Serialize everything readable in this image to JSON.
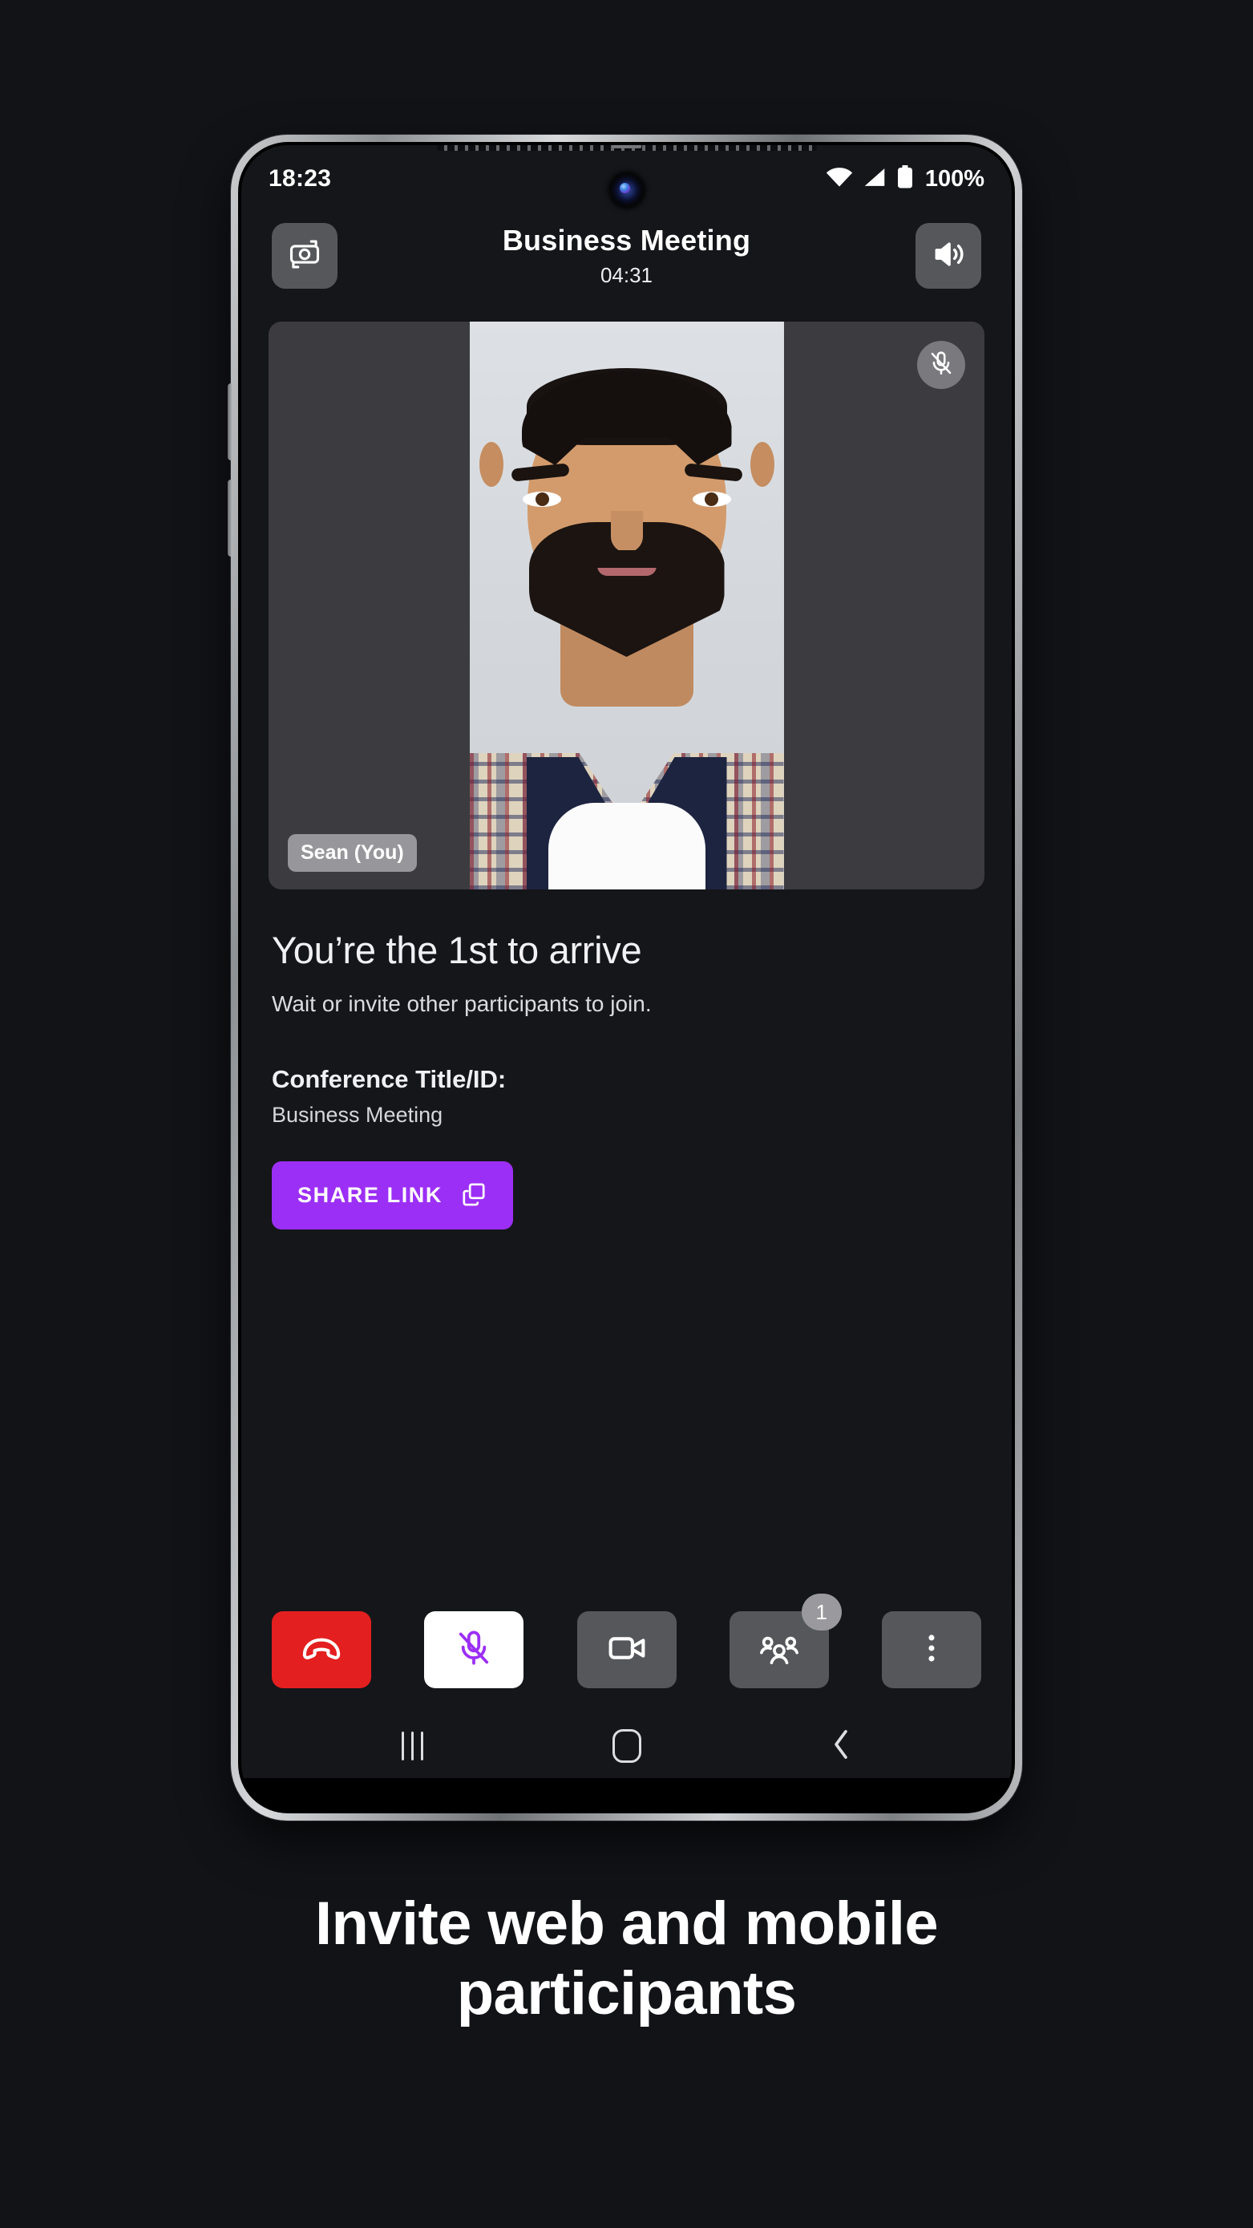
{
  "status_bar": {
    "time": "18:23",
    "battery_percent": "100%",
    "icons": [
      "wifi-icon",
      "cellular-signal-icon",
      "battery-icon"
    ]
  },
  "header": {
    "camera_flip_icon": "camera-flip-icon",
    "title": "Business Meeting",
    "timer": "04:31",
    "speaker_icon": "speaker-on-icon"
  },
  "video_tile": {
    "name_badge": "Sean (You)",
    "mute_indicator_icon": "microphone-off-icon",
    "letterbox_color": "#3C3C40"
  },
  "info": {
    "heading": "You’re the 1st to arrive",
    "subtext": "Wait or invite other participants to join.",
    "conference_label": "Conference Title/ID:",
    "conference_value": "Business Meeting",
    "share_button_label": "SHARE LINK",
    "share_button_icon": "copy-icon",
    "share_button_color": "#9C2FF5"
  },
  "controls": [
    {
      "name": "end-call",
      "icon": "phone-hangup-icon",
      "style": "red"
    },
    {
      "name": "microphone",
      "icon": "microphone-off-icon",
      "style": "white",
      "active": true
    },
    {
      "name": "camera",
      "icon": "video-camera-icon",
      "style": "grey"
    },
    {
      "name": "participants",
      "icon": "participants-icon",
      "style": "grey",
      "badge": "1"
    },
    {
      "name": "more-options",
      "icon": "more-vertical-icon",
      "style": "grey"
    }
  ],
  "android_nav": {
    "recents_icon": "recents-icon",
    "home_icon": "home-icon",
    "back_icon": "back-icon"
  },
  "caption": {
    "line1": "Invite web and mobile",
    "line2": "participants"
  }
}
